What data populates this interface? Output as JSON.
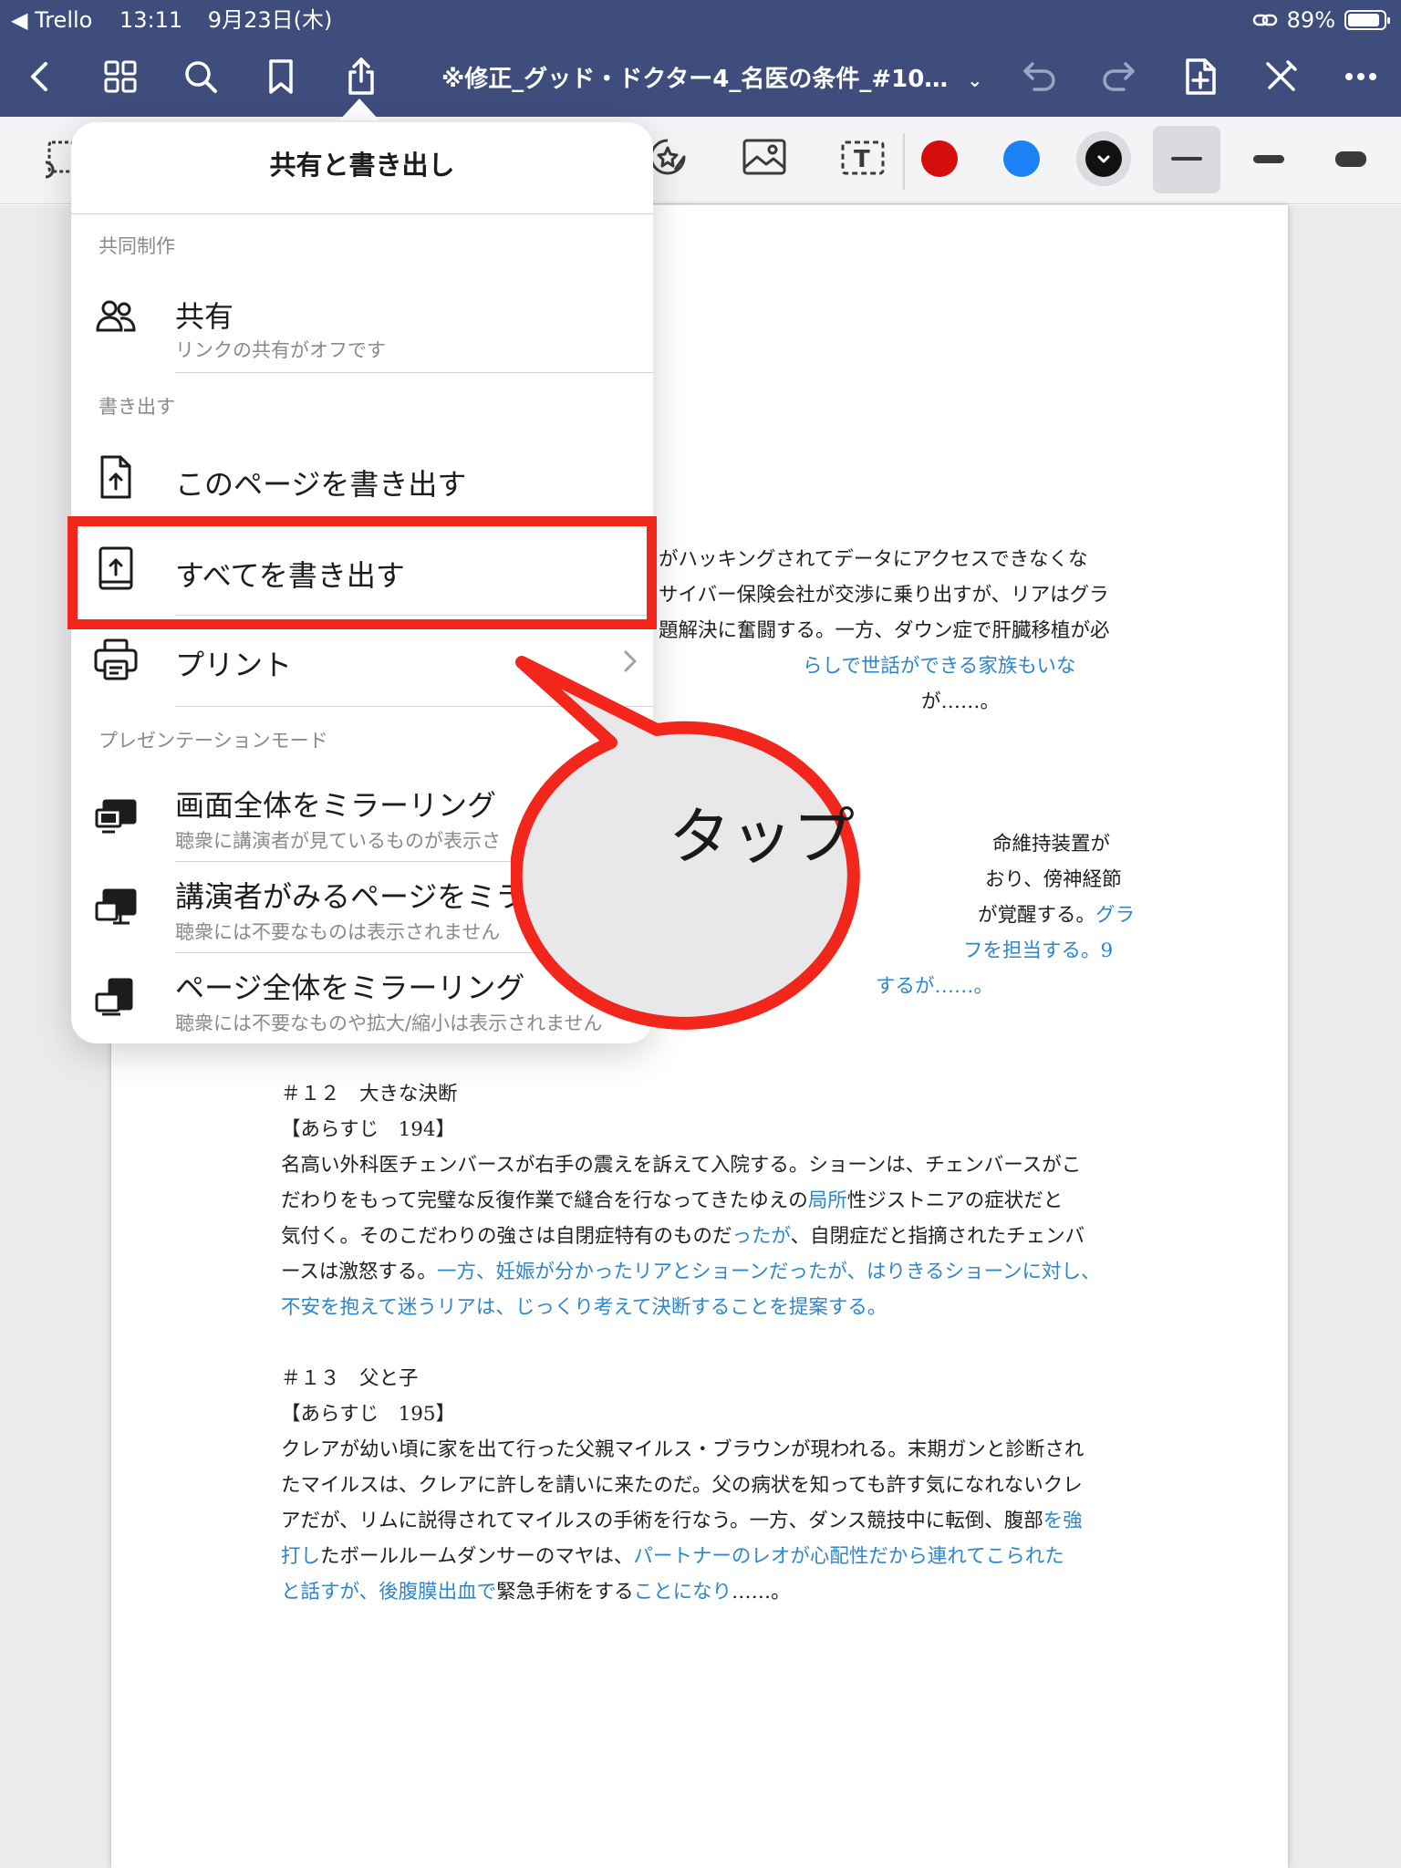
{
  "status_bar": {
    "back_app": "◀ Trello",
    "time": "13:11",
    "date": "9月23日(木)",
    "battery": "89%",
    "battery_level": 0.89
  },
  "nav": {
    "title": "※修正_グッド・ドクター4_名医の条件_#10…"
  },
  "toolbar": {
    "colors": [
      "#d40d0d",
      "#1a82f5",
      "#111111"
    ]
  },
  "popover": {
    "title": "共有と書き出し",
    "sections": {
      "collab": "共同制作",
      "export": "書き出す",
      "presentation": "プレゼンテーションモード"
    },
    "share": {
      "title": "共有",
      "subtitle": "リンクの共有がオフです"
    },
    "export_page": "このページを書き出す",
    "export_all": "すべてを書き出す",
    "print": "プリント",
    "mirror_screen": {
      "title": "画面全体をミラーリング",
      "subtitle": "聴衆に講演者が見ているものが表示さ"
    },
    "mirror_presenter": {
      "title": "講演者がみるページをミラ",
      "subtitle": "聴衆には不要なものは表示されません"
    },
    "mirror_page": {
      "title": "ページ全体をミラーリング",
      "subtitle": "聴衆には不要なものや拡大/縮小は表示されません"
    }
  },
  "callout": {
    "text": "タップ"
  },
  "document": {
    "upper_fragments": [
      "がハッキングされてデータにアクセスできなくな",
      "サイバー保険会社が交渉に乗り出すが、リアはグラ",
      "題解決に奮闘する。一方、ダウン症で肝臓移植が必",
      "らしで世話ができる家族もいな",
      "が……。",
      "命維持装置が",
      "おり、傍神経節",
      "が覚醒する。",
      "グラ",
      "フを担当する。9",
      "するが……。"
    ],
    "ep12": {
      "heading": "＃１２　大きな決断",
      "synopsis": "【あらすじ　194】",
      "l1": "名高い外科医チェンバースが右手の震えを訴えて入院する。ショーンは、チェンバースがこ",
      "l2a": "だわりをもって完璧な反復作業で縫合を行なってきたゆえの",
      "l2b": "局所",
      "l2c": "性ジストニアの症状だと",
      "l3a": "気付く。そのこだわりの強さは自閉症特有のものだ",
      "l3b": "ったが",
      "l3c": "、自閉症だと指摘されたチェンバ",
      "l4a": "ースは激怒する。",
      "l4b": "一方、妊娠が分かったリアとショーンだったが、はりきるショーンに対し、",
      "l5": "不安を抱えて迷うリアは、じっくり考えて決断することを提案する。"
    },
    "ep13": {
      "heading": "＃１３　父と子",
      "synopsis": "【あらすじ　195】",
      "l1": "クレアが幼い頃に家を出て行った父親マイルス・ブラウンが現われる。末期ガンと診断され",
      "l2": "たマイルスは、クレアに許しを請いに来たのだ。父の病状を知っても許す気になれないクレ",
      "l3a": "アだが、リムに説得されてマイルスの手術を行なう。一方、ダンス競技中に転倒、腹部",
      "l3b": "を強",
      "l4a": "打し",
      "l4b": "たボールルームダンサーのマヤは、",
      "l4c": "パートナーのレオが心配性だから連れてこられた",
      "l5a": "と話すが、後腹膜出血で",
      "l5b": "緊急手術をする",
      "l5c": "ことになり",
      "l5d": "……。"
    }
  }
}
